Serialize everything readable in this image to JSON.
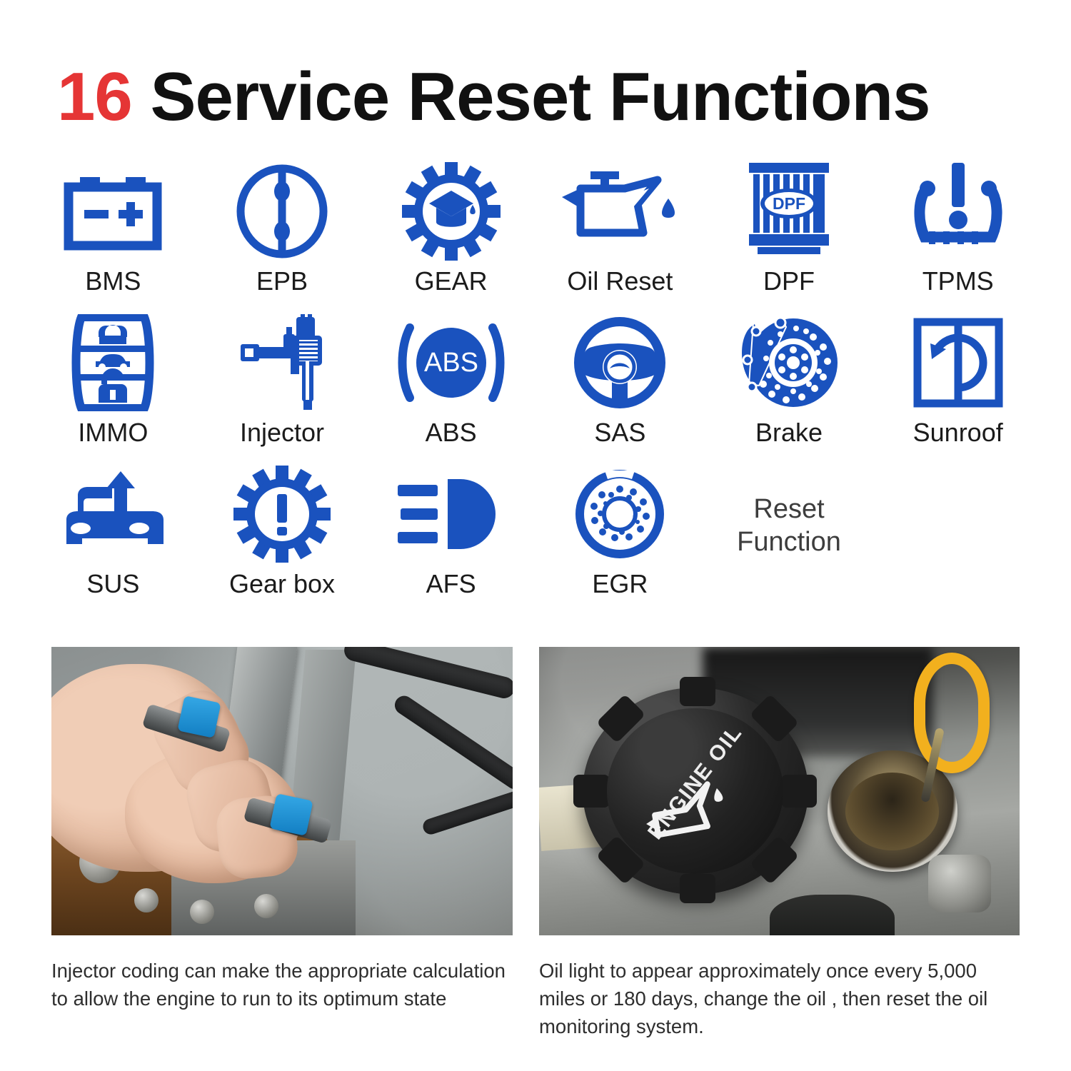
{
  "header": {
    "count": "16",
    "title_rest": " Service Reset Functions",
    "accent_red": "#E53535",
    "icon_blue": "#1A52BE"
  },
  "functions": {
    "rows": [
      [
        {
          "label": "BMS",
          "icon": "battery-icon"
        },
        {
          "label": "EPB",
          "icon": "electronic-parking-brake-icon"
        },
        {
          "label": "GEAR",
          "icon": "gear-learning-icon"
        },
        {
          "label": "Oil Reset",
          "icon": "oil-can-icon"
        },
        {
          "label": "DPF",
          "icon": "dpf-filter-icon"
        },
        {
          "label": "TPMS",
          "icon": "tire-pressure-icon"
        }
      ],
      [
        {
          "label": "IMMO",
          "icon": "key-fob-lock-icon"
        },
        {
          "label": "Injector",
          "icon": "fuel-injector-icon"
        },
        {
          "label": "ABS",
          "icon": "abs-icon"
        },
        {
          "label": "SAS",
          "icon": "steering-wheel-icon"
        },
        {
          "label": "Brake",
          "icon": "brake-disc-caliper-icon"
        },
        {
          "label": "Sunroof",
          "icon": "sunroof-icon"
        }
      ],
      [
        {
          "label": "SUS",
          "icon": "suspension-car-icon"
        },
        {
          "label": "Gear box",
          "icon": "gearbox-warning-icon"
        },
        {
          "label": "AFS",
          "icon": "headlight-icon"
        },
        {
          "label": "EGR",
          "icon": "egr-valve-icon"
        },
        {
          "label": "",
          "icon": ""
        },
        {
          "label": "",
          "icon": ""
        }
      ]
    ],
    "dpf_badge": "DPF",
    "abs_badge": "ABS",
    "reset_function_text": "Reset\nFunction"
  },
  "photos": [
    {
      "name": "injector-coding-photo",
      "caption": "Injector coding can make the appropriate calculation to allow the engine to run to its optimum state"
    },
    {
      "name": "engine-oil-cap-photo",
      "cap_text": "ENGINE OIL",
      "caption": "Oil light to appear approximately once every 5,000 miles or 180 days, change the oil , then reset the oil monitoring system."
    }
  ]
}
